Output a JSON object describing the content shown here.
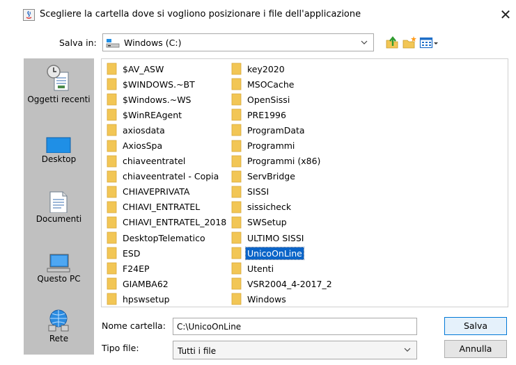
{
  "window": {
    "title": "Scegliere la cartella dove si vogliono posizionare i file dell'applicazione",
    "close_glyph": "✕"
  },
  "save_in": {
    "label": "Salva in:",
    "value": "Windows  (C:)"
  },
  "toolbar": {
    "icons": [
      "up-folder-icon",
      "new-folder-icon",
      "view-menu-icon"
    ]
  },
  "places": [
    {
      "label": "Oggetti recenti",
      "icon": "recent-items-icon"
    },
    {
      "label": "Desktop",
      "icon": "desktop-icon"
    },
    {
      "label": "Documenti",
      "icon": "documents-icon"
    },
    {
      "label": "Questo PC",
      "icon": "computer-icon"
    },
    {
      "label": "Rete",
      "icon": "network-icon"
    }
  ],
  "files": {
    "column1": [
      "$AV_ASW",
      "$WINDOWS.~BT",
      "$Windows.~WS",
      "$WinREAgent",
      "axiosdata",
      "AxiosSpa",
      "chiaveentratel",
      "chiaveentratel - Copia",
      "CHIAVEPRIVATA",
      "CHIAVI_ENTRATEL",
      "CHIAVI_ENTRATEL_2018",
      "DesktopTelematico",
      "ESD",
      "F24EP",
      "GIAMBA62",
      "hpswsetup"
    ],
    "column2": [
      "key2020",
      "MSOCache",
      "OpenSissi",
      "PRE1996",
      "ProgramData",
      "Programmi",
      "Programmi (x86)",
      "ServBridge",
      "SISSI",
      "sissicheck",
      "SWSetup",
      "ULTIMO SISSI",
      "UnicoOnLine",
      "Utenti",
      "VSR2004_4-2017_2",
      "Windows"
    ],
    "selected": "UnicoOnLine"
  },
  "form": {
    "folder_name_label": "Nome cartella:",
    "folder_name_value": "C:\\UnicoOnLine",
    "file_type_label": "Tipo file:",
    "file_type_value": "Tutti i file"
  },
  "buttons": {
    "save": "Salva",
    "cancel": "Annulla"
  },
  "colors": {
    "selection": "#0a64c8",
    "folder": "#f2c655",
    "sidebar": "#c0c0c0"
  }
}
